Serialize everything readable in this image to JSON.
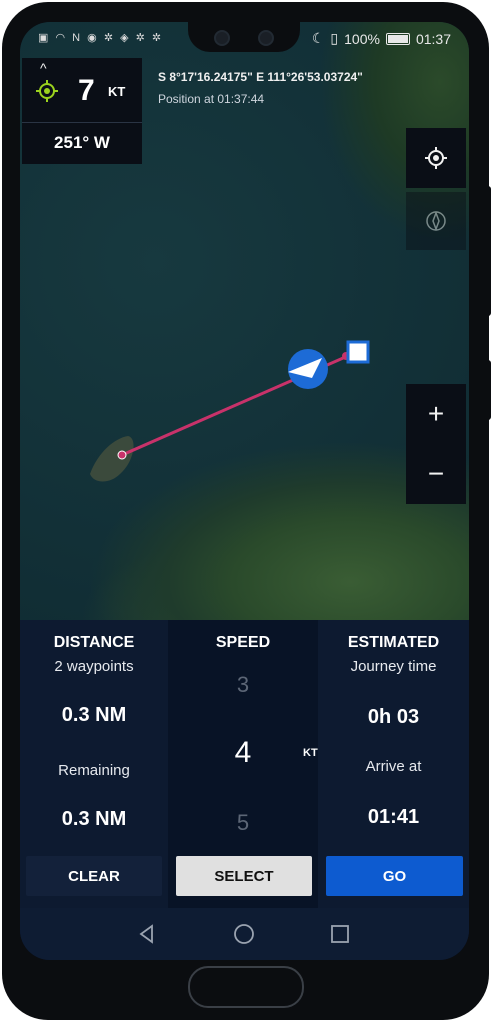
{
  "status_bar": {
    "left_icons": [
      "sim-icon",
      "wifi-icon",
      "nfc-icon",
      "location-icon",
      "settings-icon",
      "gps-icon",
      "settings-icon",
      "settings-icon"
    ],
    "battery": "100%",
    "time": "01:37"
  },
  "speed_box": {
    "speed_value": "7",
    "speed_unit": "KT",
    "heading": "251° W"
  },
  "position": {
    "coordinates": "S 8°17'16.24175\"   E 111°26'53.03724\"",
    "position_at": "Position at 01:37:44"
  },
  "map_controls": {
    "zoom_in": "+",
    "zoom_out": "−"
  },
  "panel": {
    "distance": {
      "header": "DISTANCE",
      "sub": "2 waypoints",
      "value": "0.3 NM",
      "remaining_label": "Remaining",
      "remaining_value": "0.3 NM"
    },
    "speed": {
      "header": "SPEED",
      "prev": "3",
      "current": "4",
      "next": "5",
      "unit": "KT"
    },
    "estimated": {
      "header": "ESTIMATED",
      "sub": "Journey time",
      "journey_value": "0h 03",
      "arrive_label": "Arrive at",
      "arrive_value": "01:41"
    },
    "buttons": {
      "clear": "CLEAR",
      "select": "SELECT",
      "go": "GO"
    }
  },
  "colors": {
    "route_line": "#c8326a",
    "accent_go": "#0d5bd0",
    "gps_green": "#9bd21e",
    "boat_blue": "#1d6bd6"
  }
}
